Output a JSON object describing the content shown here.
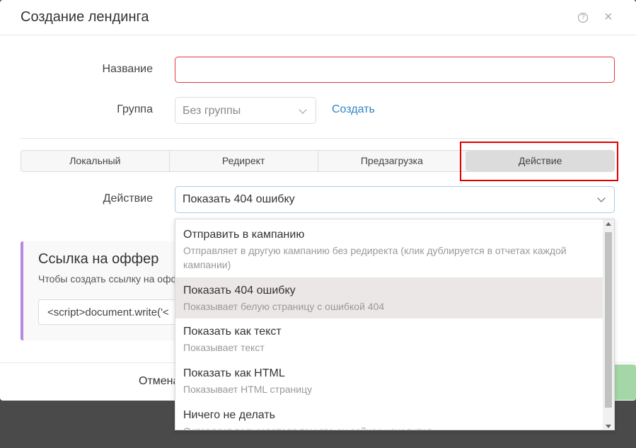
{
  "modal": {
    "title": "Создание лендинга",
    "help_icon": "question-circle-icon",
    "help_glyph": "?",
    "close_icon": "close-icon",
    "close_glyph": "×"
  },
  "form": {
    "name_label": "Название",
    "name_value": "",
    "group_label": "Группа",
    "group_value": "Без группы",
    "create_link": "Создать",
    "action_label": "Действие",
    "action_value": "Показать 404 ошибку"
  },
  "tabs": [
    {
      "label": "Локальный",
      "active": false
    },
    {
      "label": "Редирект",
      "active": false
    },
    {
      "label": "Предзагрузка",
      "active": false
    },
    {
      "label": "Действие",
      "active": true
    }
  ],
  "highlight_color": "#e00000",
  "offer": {
    "title": "Ссылка на оффер",
    "description": "Чтобы создать ссылку на офф",
    "code": "<script>document.write('<"
  },
  "footer": {
    "cancel_label": "Отмена"
  },
  "dropdown": {
    "options": [
      {
        "title": "Отправить в кампанию",
        "desc": "Отправляет в другую кампанию без редиректа (клик дублируется в отчетах каждой кампании)",
        "selected": false
      },
      {
        "title": "Показать 404 ошибку",
        "desc": "Показывает белую страницу с ошибкой 404",
        "selected": true
      },
      {
        "title": "Показать как текст",
        "desc": "Показывает текст",
        "selected": false
      },
      {
        "title": "Показать как HTML",
        "desc": "Показывает HTML страницу",
        "selected": false
      },
      {
        "title": "Ничего не делать",
        "desc": "Оставляет пользователя там где он сейчас находится",
        "selected": false
      }
    ]
  }
}
